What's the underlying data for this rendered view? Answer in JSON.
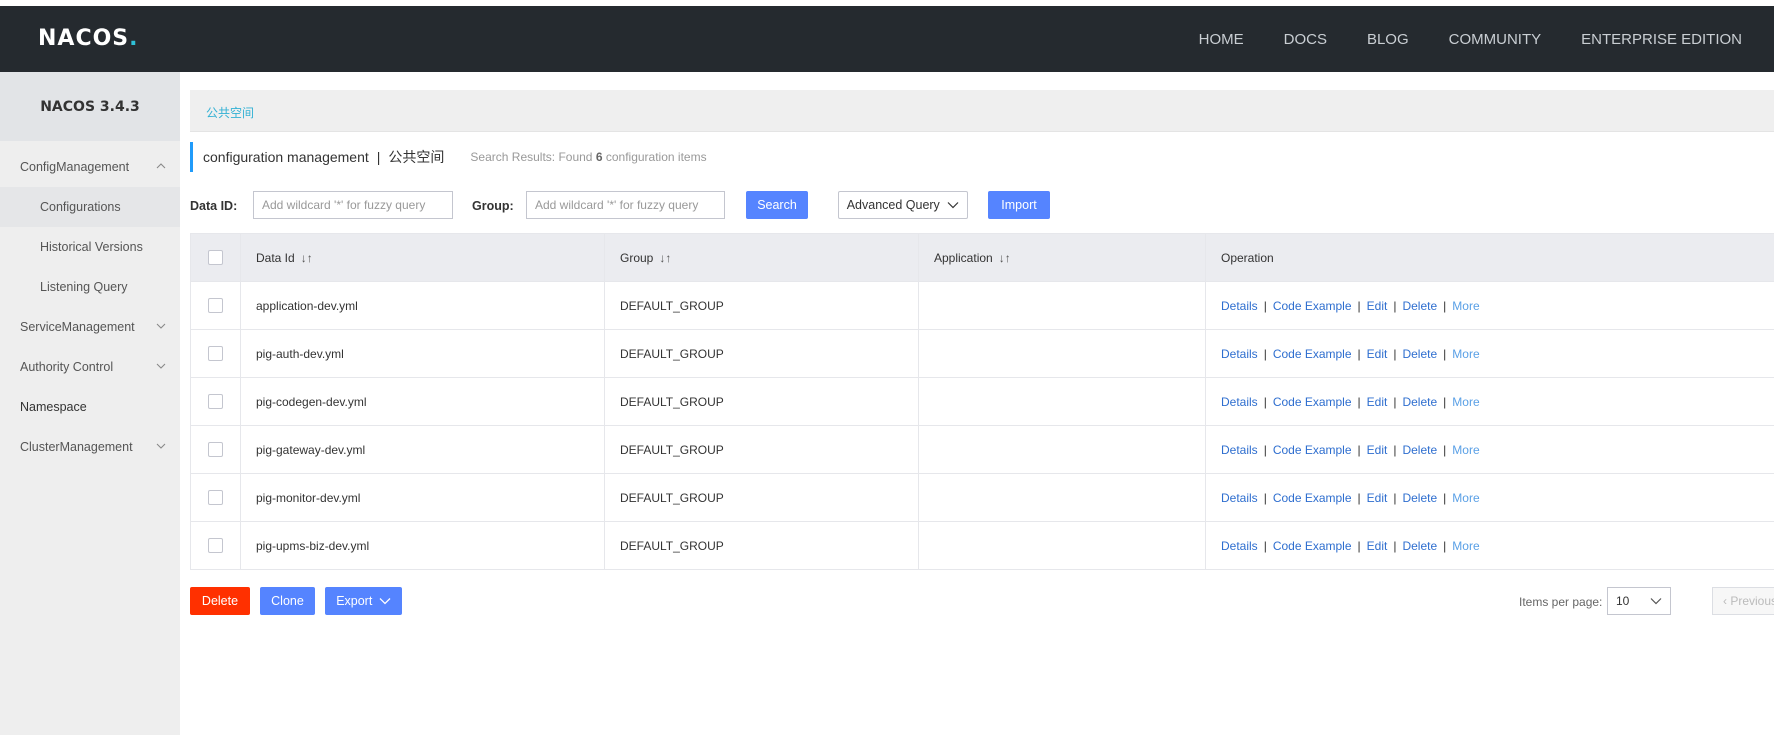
{
  "header": {
    "logo_text": "NACOS",
    "logo_dot": ".",
    "nav": [
      "HOME",
      "DOCS",
      "BLOG",
      "COMMUNITY",
      "ENTERPRISE EDITION"
    ]
  },
  "sidebar": {
    "version": "NACOS 3.4.3",
    "items": [
      {
        "label": "ConfigManagement",
        "chevron": "up"
      },
      {
        "label": "Configurations"
      },
      {
        "label": "Historical Versions"
      },
      {
        "label": "Listening Query"
      },
      {
        "label": "ServiceManagement",
        "chevron": "down"
      },
      {
        "label": "Authority Control",
        "chevron": "down"
      },
      {
        "label": "Namespace"
      },
      {
        "label": "ClusterManagement",
        "chevron": "down"
      }
    ]
  },
  "namespace_bar": {
    "link": "公共空间"
  },
  "title": {
    "main": "configuration management",
    "sep": "|",
    "namespace": "公共空间",
    "hint_prefix": "Search Results: Found",
    "hint_count": "6",
    "hint_suffix": "configuration items"
  },
  "filters": {
    "data_id_label": "Data ID:",
    "data_id_placeholder": "Add wildcard '*' for fuzzy query",
    "group_label": "Group:",
    "group_placeholder": "Add wildcard '*' for fuzzy query",
    "search": "Search",
    "advanced": "Advanced Query",
    "import": "Import"
  },
  "table": {
    "headers": [
      "Data Id",
      "Group",
      "Application",
      "Operation"
    ],
    "rows": [
      {
        "data_id": "application-dev.yml",
        "group": "DEFAULT_GROUP",
        "app": ""
      },
      {
        "data_id": "pig-auth-dev.yml",
        "group": "DEFAULT_GROUP",
        "app": ""
      },
      {
        "data_id": "pig-codegen-dev.yml",
        "group": "DEFAULT_GROUP",
        "app": ""
      },
      {
        "data_id": "pig-gateway-dev.yml",
        "group": "DEFAULT_GROUP",
        "app": ""
      },
      {
        "data_id": "pig-monitor-dev.yml",
        "group": "DEFAULT_GROUP",
        "app": ""
      },
      {
        "data_id": "pig-upms-biz-dev.yml",
        "group": "DEFAULT_GROUP",
        "app": ""
      }
    ],
    "operations": [
      "Details",
      "Code Example",
      "Edit",
      "Delete",
      "More"
    ],
    "op_sep": "|"
  },
  "bottom": {
    "delete": "Delete",
    "clone": "Clone",
    "export": "Export",
    "items_per_page_label": "Items per page:",
    "items_per_page": "10",
    "prev": "Previous"
  }
}
